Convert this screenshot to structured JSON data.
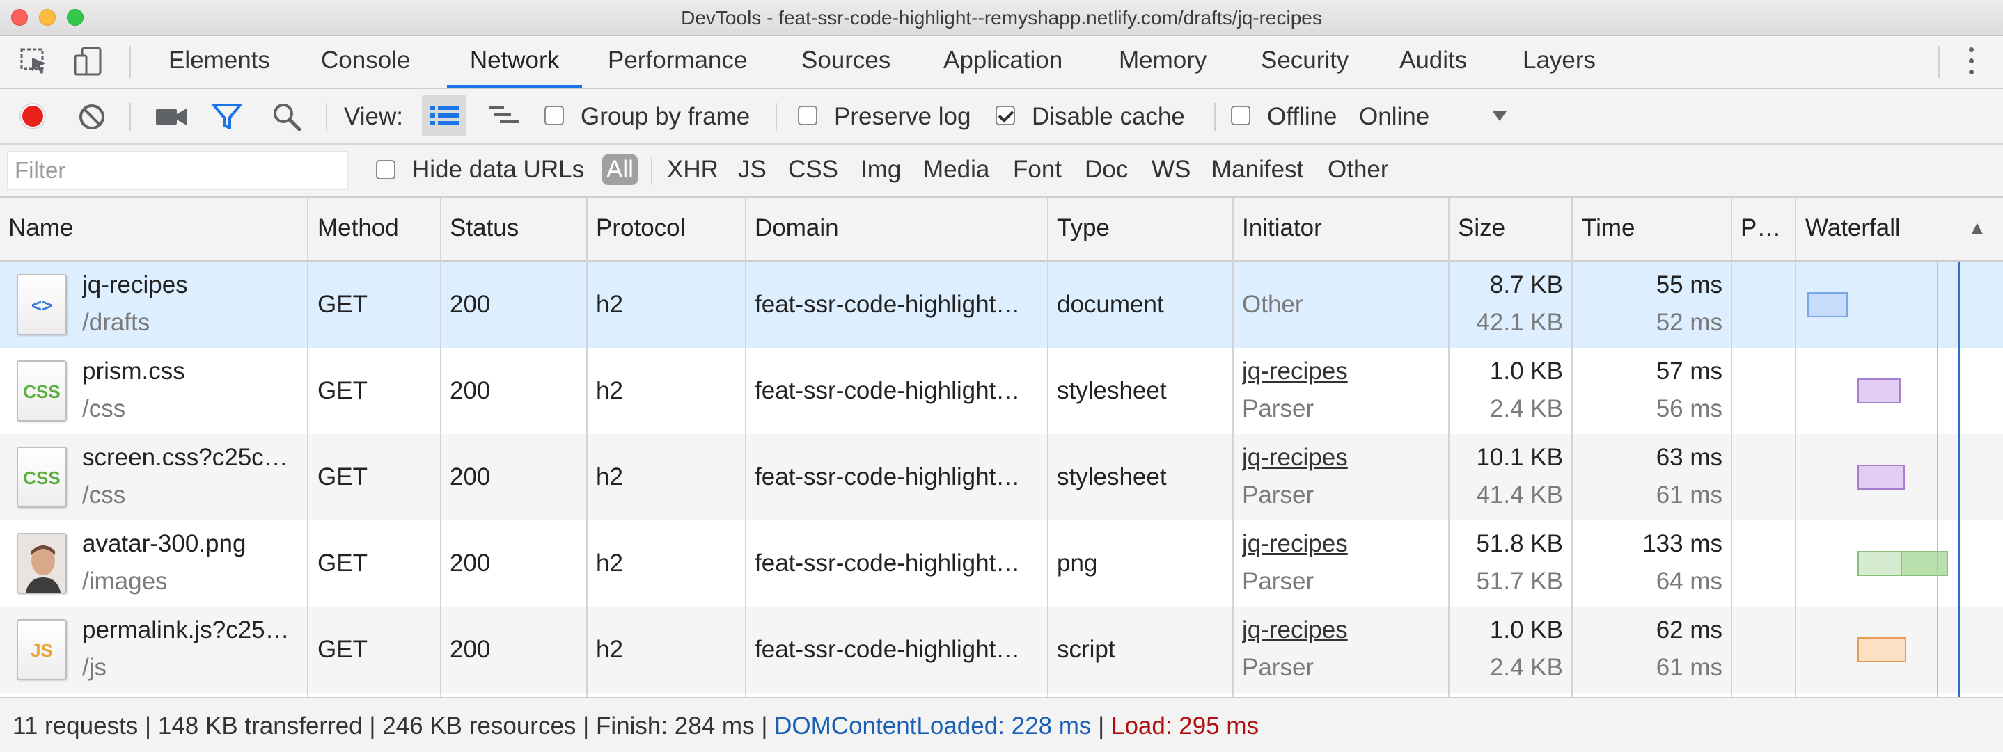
{
  "window": {
    "title": "DevTools - feat-ssr-code-highlight--remyshарp.netlify.com/drafts/jq-recipes"
  },
  "tabs": [
    {
      "label": "Elements"
    },
    {
      "label": "Console"
    },
    {
      "label": "Network",
      "active": true
    },
    {
      "label": "Performance"
    },
    {
      "label": "Sources"
    },
    {
      "label": "Application"
    },
    {
      "label": "Memory"
    },
    {
      "label": "Security"
    },
    {
      "label": "Audits"
    },
    {
      "label": "Layers"
    }
  ],
  "toolbar": {
    "view_label": "View:",
    "group_by_frame": {
      "label": "Group by frame",
      "checked": false
    },
    "preserve_log": {
      "label": "Preserve log",
      "checked": false
    },
    "disable_cache": {
      "label": "Disable cache",
      "checked": true
    },
    "offline": {
      "label": "Offline",
      "checked": false
    },
    "throttling": "Online",
    "record_color": "#e8221b",
    "filter_icon_color": "#1a73e8"
  },
  "filter": {
    "placeholder": "Filter",
    "value": "",
    "hide_data_urls": {
      "label": "Hide data URLs",
      "checked": false
    },
    "types": [
      "All",
      "XHR",
      "JS",
      "CSS",
      "Img",
      "Media",
      "Font",
      "Doc",
      "WS",
      "Manifest",
      "Other"
    ],
    "active_type": "All"
  },
  "columns": {
    "name": "Name",
    "method": "Method",
    "status": "Status",
    "protocol": "Protocol",
    "domain": "Domain",
    "type": "Type",
    "initiator": "Initiator",
    "size": "Size",
    "time": "Time",
    "priority": "P…",
    "waterfall": "Waterfall",
    "sort_indicator": "▲"
  },
  "rows": [
    {
      "name": "jq-recipes",
      "path": "/drafts",
      "method": "GET",
      "status": "200",
      "protocol": "h2",
      "domain": "feat-ssr-code-highlight…",
      "type": "document",
      "initiator": "Other",
      "initiator_sub": "",
      "size": "8.7 KB",
      "size_sub": "42.1 KB",
      "time": "55 ms",
      "time_sub": "52 ms",
      "icon": "html-document-icon",
      "icon_text": "<>",
      "icon_color": "#3b7ad6",
      "waterfall_color": "#c6dcfa",
      "waterfall_border": "#7ca6e6"
    },
    {
      "name": "prism.css",
      "path": "/css",
      "method": "GET",
      "status": "200",
      "protocol": "h2",
      "domain": "feat-ssr-code-highlight…",
      "type": "stylesheet",
      "initiator": "jq-recipes",
      "initiator_sub": "Parser",
      "size": "1.0 KB",
      "size_sub": "2.4 KB",
      "time": "57 ms",
      "time_sub": "56 ms",
      "icon": "css-file-icon",
      "icon_text": "CSS",
      "icon_color": "#5aae3a",
      "waterfall_color": "#e2cdf5",
      "waterfall_border": "#a77fd0"
    },
    {
      "name": "screen.css?c25c…",
      "path": "/css",
      "method": "GET",
      "status": "200",
      "protocol": "h2",
      "domain": "feat-ssr-code-highlight…",
      "type": "stylesheet",
      "initiator": "jq-recipes",
      "initiator_sub": "Parser",
      "size": "10.1 KB",
      "size_sub": "41.4 KB",
      "time": "63 ms",
      "time_sub": "61 ms",
      "icon": "css-file-icon",
      "icon_text": "CSS",
      "icon_color": "#5aae3a",
      "waterfall_color": "#e2cdf5",
      "waterfall_border": "#a77fd0"
    },
    {
      "name": "avatar-300.png",
      "path": "/images",
      "method": "GET",
      "status": "200",
      "protocol": "h2",
      "domain": "feat-ssr-code-highlight…",
      "type": "png",
      "initiator": "jq-recipes",
      "initiator_sub": "Parser",
      "size": "51.8 KB",
      "size_sub": "51.7 KB",
      "time": "133 ms",
      "time_sub": "64 ms",
      "icon": "avatar-thumbnail-icon",
      "icon_text": "",
      "icon_color": "#b07a5a",
      "waterfall_color": "#d6ecd0",
      "waterfall_border": "#86c079"
    },
    {
      "name": "permalink.js?c25…",
      "path": "/js",
      "method": "GET",
      "status": "200",
      "protocol": "h2",
      "domain": "feat-ssr-code-highlight…",
      "type": "script",
      "initiator": "jq-recipes",
      "initiator_sub": "Parser",
      "size": "1.0 KB",
      "size_sub": "2.4 KB",
      "time": "62 ms",
      "time_sub": "61 ms",
      "icon": "js-file-icon",
      "icon_text": "JS",
      "icon_color": "#f0a030",
      "waterfall_color": "#fde0c4",
      "waterfall_border": "#e59a55"
    }
  ],
  "summary": {
    "requests": "11 requests",
    "transferred": "148 KB transferred",
    "resources": "246 KB resources",
    "finish": "Finish: 284 ms",
    "dom_content_loaded": "DOMContentLoaded: 228 ms",
    "load": "Load: 295 ms",
    "separator": "|",
    "dcl_color": "#1a5fb4",
    "load_color": "#b00f0f"
  }
}
